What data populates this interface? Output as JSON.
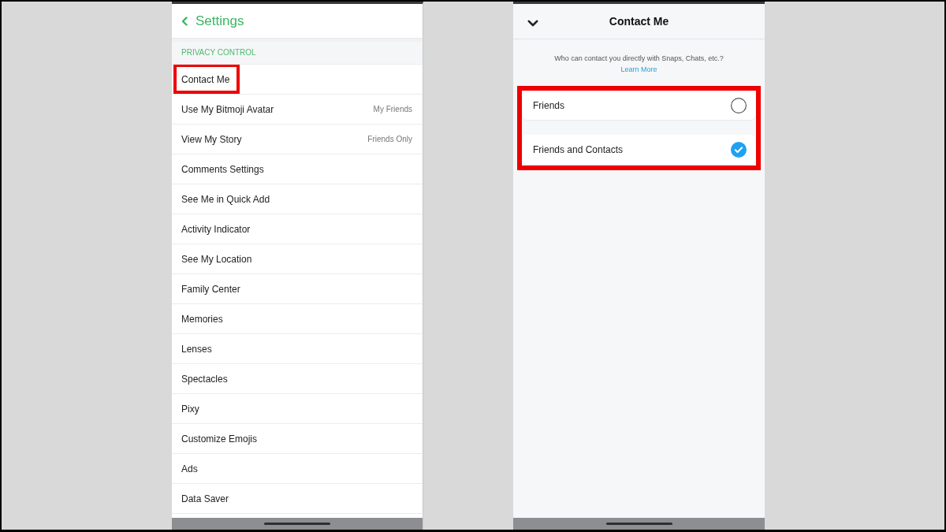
{
  "settings_screen": {
    "back_label": "Settings",
    "section_header": "PRIVACY CONTROL",
    "rows": [
      {
        "label": "Contact Me",
        "highlighted": true
      },
      {
        "label": "Use My Bitmoji Avatar",
        "value": "My Friends",
        "highlighted": false
      },
      {
        "label": "View My Story",
        "value": "Friends Only",
        "highlighted": false
      },
      {
        "label": "Comments Settings",
        "highlighted": false
      },
      {
        "label": "See Me in Quick Add",
        "highlighted": false
      },
      {
        "label": "Activity Indicator",
        "highlighted": false
      },
      {
        "label": "See My Location",
        "highlighted": false
      },
      {
        "label": "Family Center",
        "highlighted": false
      },
      {
        "label": "Memories",
        "highlighted": false
      },
      {
        "label": "Lenses",
        "highlighted": false
      },
      {
        "label": "Spectacles",
        "highlighted": false
      },
      {
        "label": "Pixy",
        "highlighted": false
      },
      {
        "label": "Customize Emojis",
        "highlighted": false
      },
      {
        "label": "Ads",
        "highlighted": false
      },
      {
        "label": "Data Saver",
        "highlighted": false
      }
    ]
  },
  "contact_me_screen": {
    "title": "Contact Me",
    "description": "Who can contact you directly with Snaps, Chats, etc.?",
    "link": "Learn More",
    "options": {
      "highlighted": true,
      "items": [
        {
          "label": "Friends",
          "selected": false
        },
        {
          "label": "Friends and Contacts",
          "selected": true
        }
      ]
    }
  }
}
